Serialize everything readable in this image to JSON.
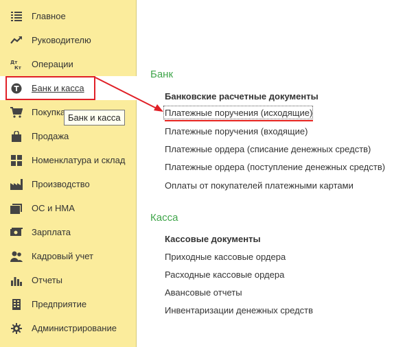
{
  "sidebar": {
    "items": [
      {
        "label": "Главное",
        "icon": "menu-lines-icon"
      },
      {
        "label": "Руководителю",
        "icon": "trend-chart-icon"
      },
      {
        "label": "Операции",
        "icon": "debit-credit-icon"
      },
      {
        "label": "Банк и касса",
        "icon": "coin-icon",
        "active": true
      },
      {
        "label": "Покупка",
        "icon": "cart-icon"
      },
      {
        "label": "Продажа",
        "icon": "shopping-bag-icon"
      },
      {
        "label": "Номенклатура и склад",
        "icon": "grid-icon"
      },
      {
        "label": "Производство",
        "icon": "factory-icon"
      },
      {
        "label": "ОС и НМА",
        "icon": "folder-stack-icon"
      },
      {
        "label": "Зарплата",
        "icon": "money-icon"
      },
      {
        "label": "Кадровый учет",
        "icon": "people-icon"
      },
      {
        "label": "Отчеты",
        "icon": "bar-chart-icon"
      },
      {
        "label": "Предприятие",
        "icon": "building-icon"
      },
      {
        "label": "Администрирование",
        "icon": "gear-icon"
      }
    ]
  },
  "tooltip": "Банк и касса",
  "main": {
    "bank": {
      "title": "Банк",
      "group_header": "Банковские расчетные документы",
      "links": [
        "Платежные поручения (исходящие)",
        "Платежные поручения (входящие)",
        "Платежные ордера (списание денежных средств)",
        "Платежные ордера (поступление денежных средств)",
        "Оплаты от покупателей платежными картами"
      ]
    },
    "cash": {
      "title": "Касса",
      "group_header": "Кассовые документы",
      "links": [
        "Приходные кассовые ордера",
        "Расходные кассовые ордера",
        "Авансовые отчеты",
        "Инвентаризации денежных средств"
      ]
    }
  },
  "colors": {
    "sidebar_bg": "#fbec9c",
    "section_title": "#3fa54a",
    "highlight_red": "#e01f26"
  }
}
